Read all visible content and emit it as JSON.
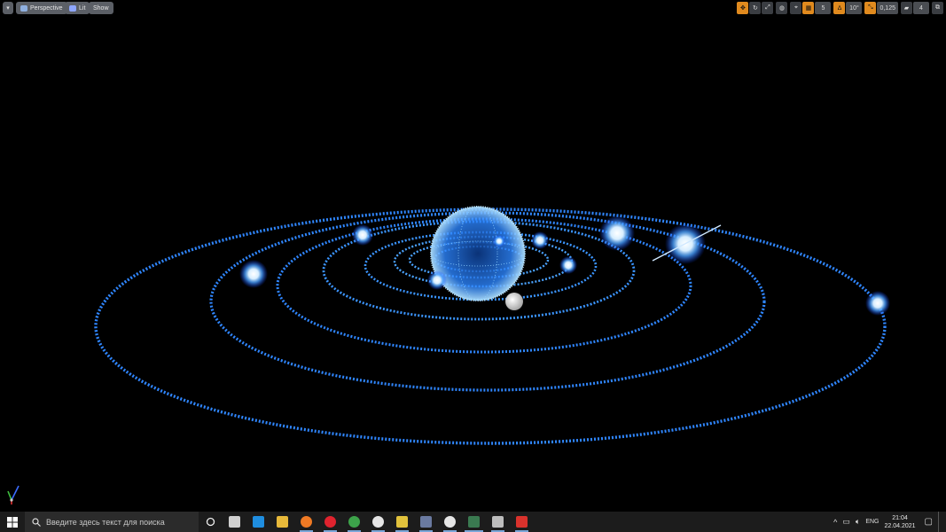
{
  "viewport": {
    "view_mode": "Perspective",
    "lit_mode": "Lit",
    "show_label": "Show",
    "toolbar_right": {
      "icons": [
        "translate-icon",
        "rotate-icon",
        "scale-icon",
        "world-local-icon"
      ],
      "grid_snap_value": "5",
      "rotation_snap_value": "10°",
      "scale_snap_value": "0,125",
      "camera_speed_value": "4"
    }
  },
  "taskbar": {
    "search_placeholder": "Введите здесь текст для поиска",
    "language": "ENG",
    "time": "21:04",
    "date": "22.04.2021",
    "apps": [
      {
        "name": "task-view",
        "color": "#cfcfcf"
      },
      {
        "name": "edge",
        "color": "#1f8ee0"
      },
      {
        "name": "file-explorer",
        "color": "#e8b93a"
      },
      {
        "name": "firefox",
        "color": "#f07a24"
      },
      {
        "name": "opera",
        "color": "#e0232e"
      },
      {
        "name": "chrome",
        "color": "#3da34a"
      },
      {
        "name": "unreal-engine",
        "color": "#e6e6e6"
      },
      {
        "name": "app-yellow",
        "color": "#e2c23c"
      },
      {
        "name": "calculator",
        "color": "#6a7aa0"
      },
      {
        "name": "unreal-editor",
        "color": "#e6e6e6"
      },
      {
        "name": "app-window-active",
        "color": "#3a7a50"
      },
      {
        "name": "app-gray",
        "color": "#bdbdbd"
      },
      {
        "name": "app-red",
        "color": "#d9322c"
      }
    ]
  },
  "colors": {
    "orbit_glow": "#2f86ff",
    "planet_core": "#e8f6ff",
    "active_tool": "#e08a1e"
  }
}
